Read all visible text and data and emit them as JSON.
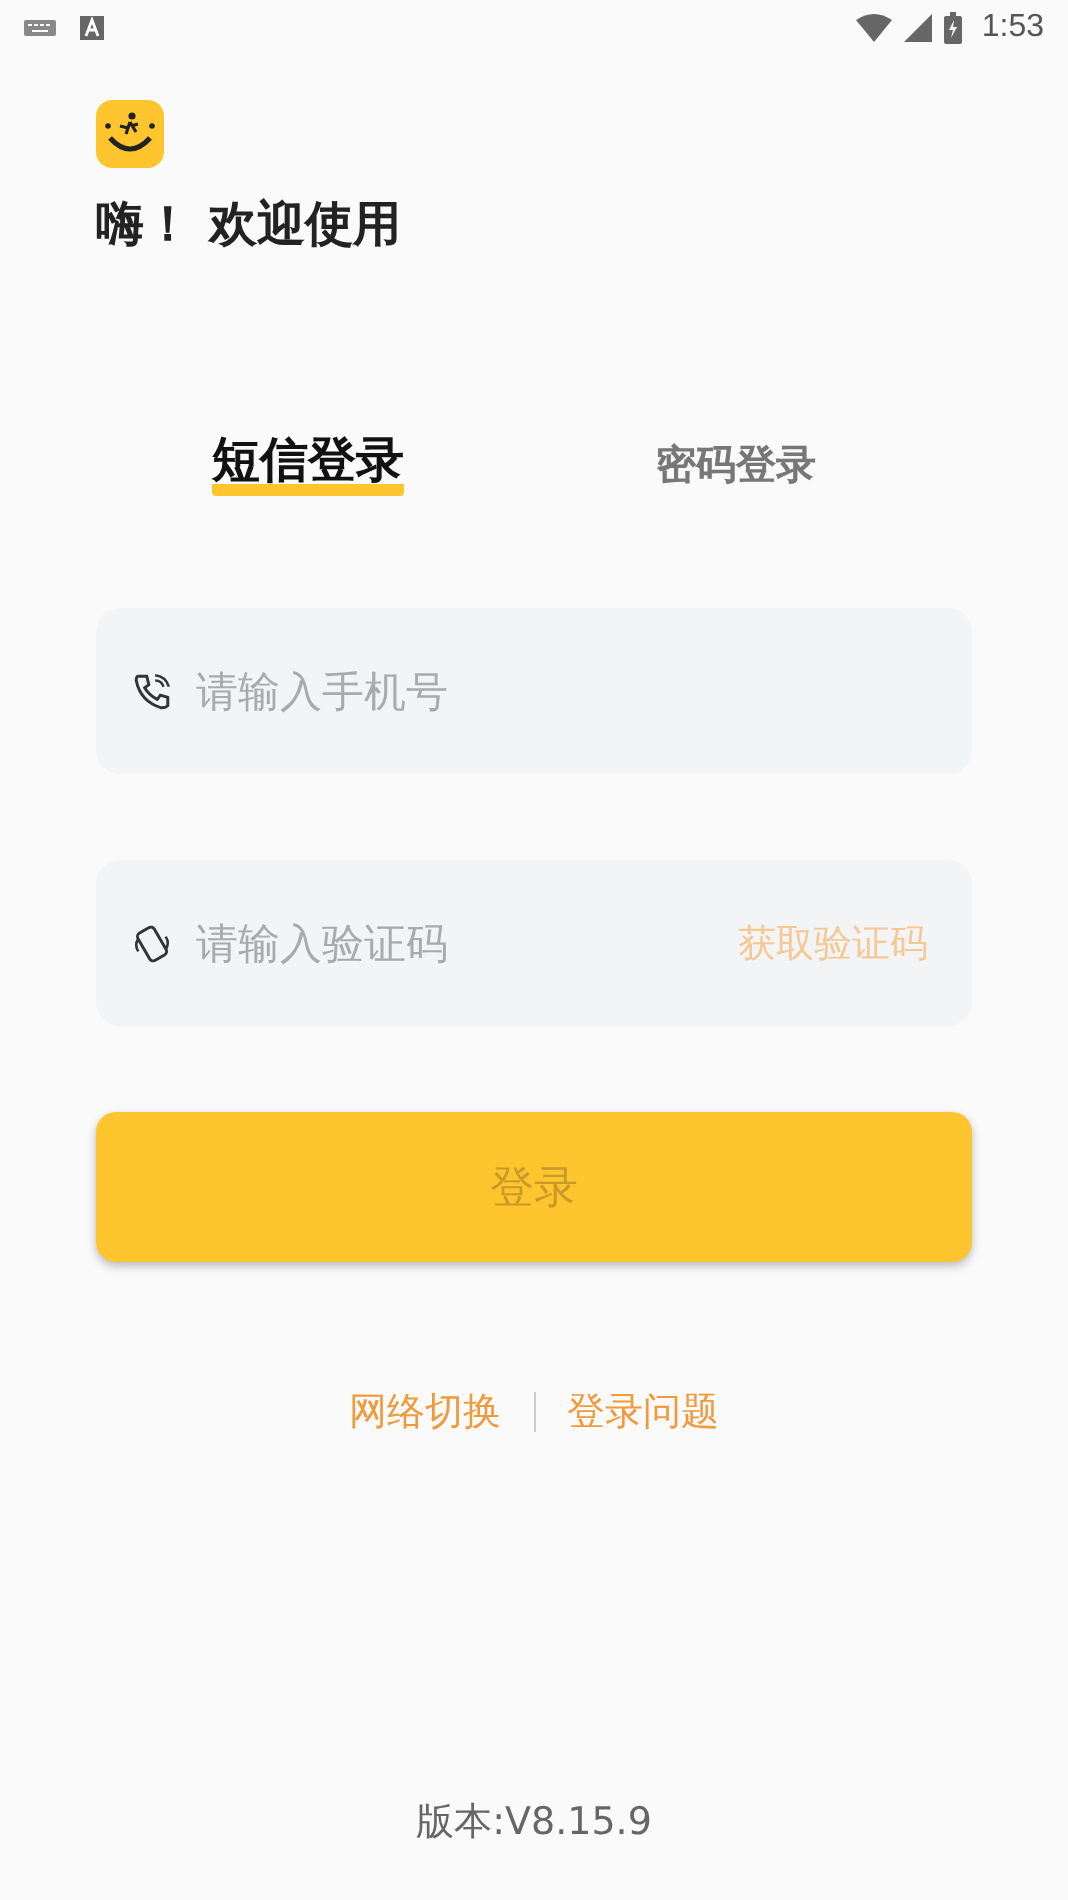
{
  "status_bar": {
    "time": "1:53"
  },
  "greeting": "嗨！ 欢迎使用",
  "tabs": [
    {
      "label": "短信登录",
      "selected": true
    },
    {
      "label": "密码登录",
      "selected": false
    }
  ],
  "fields": [
    {
      "kind": "phone",
      "placeholder": "请输入手机号"
    },
    {
      "kind": "code",
      "placeholder": "请输入验证码",
      "action": "获取验证码"
    }
  ],
  "login_button": "登录",
  "links": [
    "网络切换",
    "登录问题"
  ],
  "version": "版本:V8.15.9"
}
